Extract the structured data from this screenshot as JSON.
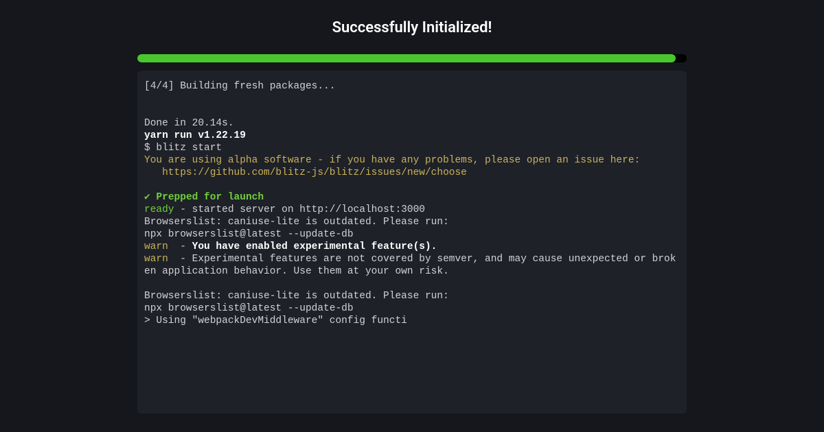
{
  "header": {
    "title": "Successfully Initialized!"
  },
  "progress": {
    "percent": 98
  },
  "terminal": {
    "step_label": "[4/4] Building fresh packages...",
    "done_line": "Done in 20.14s.",
    "yarn_line": "yarn run v1.22.19",
    "blitz_start": "$ blitz start",
    "alpha_warning": "You are using alpha software - if you have any problems, please open an issue here:\n   https://github.com/blitz-js/blitz/issues/new/choose",
    "check_mark": "✔",
    "prepped": " Prepped for launch",
    "ready_label": "ready",
    "ready_rest": " - started server on http://localhost:3000",
    "browserslist1": "Browserslist: caniuse-lite is outdated. Please run:\nnpx browserslist@latest --update-db",
    "warn_label": "warn",
    "warn1_dash": "  - ",
    "warn1_bold": "You have enabled experimental feature(s).",
    "warn2_rest": "  - Experimental features are not covered by semver, and may cause unexpected or broken application behavior. Use them at your own risk.",
    "browserslist2": "Browserslist: caniuse-lite is outdated. Please run:\nnpx browserslist@latest --update-db",
    "webpack_line": "> Using \"webpackDevMiddleware\" config functi"
  }
}
